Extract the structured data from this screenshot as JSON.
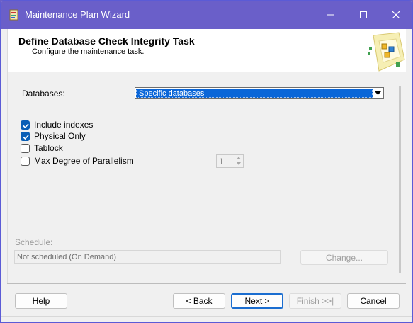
{
  "window": {
    "title": "Maintenance Plan Wizard",
    "controls": [
      "minimize-icon",
      "maximize-icon",
      "close-icon"
    ]
  },
  "header": {
    "title": "Define Database Check Integrity Task",
    "subtitle": "Configure the maintenance task."
  },
  "form": {
    "databases_label": "Databases:",
    "databases_value": "Specific databases",
    "options": [
      {
        "label": "Include indexes",
        "checked": true
      },
      {
        "label": "Physical Only",
        "checked": true
      },
      {
        "label": "Tablock",
        "checked": false
      },
      {
        "label": "Max Degree of Parallelism",
        "checked": false
      }
    ],
    "parallelism_value": "1"
  },
  "schedule": {
    "label": "Schedule:",
    "value": "Not scheduled (On Demand)",
    "change_label": "Change..."
  },
  "footer": {
    "help_label": "Help",
    "back_label": "< Back",
    "next_label": "Next >",
    "finish_label": "Finish >>|",
    "cancel_label": "Cancel"
  },
  "colors": {
    "titlebar": "#6a5fc9",
    "selection": "#0a66d8",
    "checkbox_checked": "#0a5fb6"
  }
}
